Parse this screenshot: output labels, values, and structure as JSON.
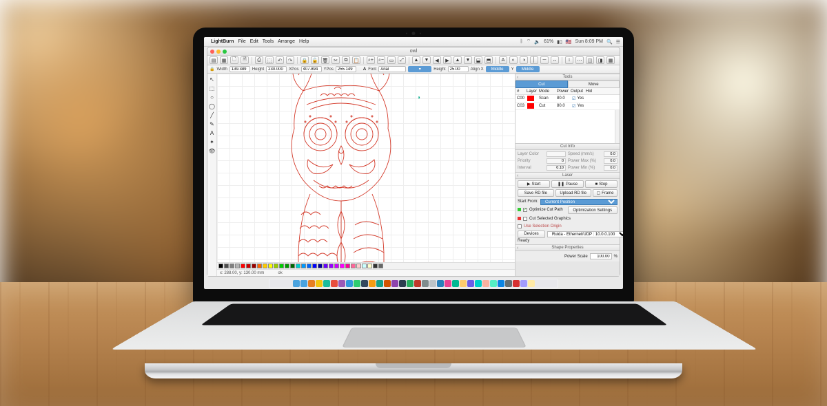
{
  "menubar": {
    "app": "LightBurn",
    "items": [
      "File",
      "Edit",
      "Tools",
      "Arrange",
      "Help"
    ],
    "battery": "61%",
    "time": "Sun 8:09 PM"
  },
  "window": {
    "title": "owl"
  },
  "toolbar_icons": [
    "▤",
    "▦",
    "🗋",
    "🗎",
    "⎙",
    "⬚",
    "↶",
    "↷",
    "🔒",
    "🔓",
    "🗑",
    "✂",
    "⧉",
    "📋",
    "⌕+",
    "⌕−",
    "▭",
    "⤢",
    "▲",
    "▼",
    "◀",
    "▶",
    "▲",
    "▼",
    "⬓",
    "⬒",
    "A",
    "◐",
    "◑",
    "│",
    "─",
    "↔",
    "↕",
    "⋯",
    "◫",
    "◨",
    "▦"
  ],
  "props": {
    "width_label": "Width",
    "width": "139.389",
    "height_label": "Height",
    "height": "230.000",
    "xpos_label": "XPos",
    "xpos": "407.894",
    "ypos_label": "YPos",
    "ypos": "255.149",
    "font_label": "Font",
    "font": "Arial",
    "height2_label": "Height",
    "height2": "25.00",
    "alignx_label": "Align X",
    "alignx": "Middle",
    "aligny_label": "Y",
    "aligny": "Middle"
  },
  "left_tools": [
    "↖",
    "⬚",
    "○",
    "◯",
    "╱",
    "✎",
    "A",
    "✦",
    "👁"
  ],
  "palette": [
    "#000000",
    "#4d4d4d",
    "#808080",
    "#b3b3b3",
    "#ff0000",
    "#cc0000",
    "#990000",
    "#ff6600",
    "#ffcc00",
    "#ffff00",
    "#99cc00",
    "#00cc00",
    "#009900",
    "#006600",
    "#00cccc",
    "#0099ff",
    "#0066ff",
    "#0000ff",
    "#000099",
    "#6600ff",
    "#9900ff",
    "#cc00ff",
    "#ff00ff",
    "#ff0099",
    "#ff6699",
    "#ffcccc",
    "#ccffff",
    "#ffffcc",
    "#333333",
    "#666666"
  ],
  "status": {
    "coords": "x: 288.00, y: 130.00 mm",
    "state": "ok"
  },
  "tools_panel": {
    "title": "Tools",
    "tabs": {
      "cut": "Cut",
      "move": "Move"
    },
    "headers": {
      "num": "#",
      "layer": "Layer",
      "mode": "Mode",
      "spd": "",
      "pwr": "Power",
      "out": "Output",
      "hid": "Hid"
    },
    "layers": [
      {
        "num": "C00",
        "color": "#ff0000",
        "mode": "Scan",
        "spd": "",
        "pwr": "80.0",
        "out": "Yes",
        "hid": ""
      },
      {
        "num": "C03",
        "color": "#ff0000",
        "mode": "Cut",
        "spd": "",
        "pwr": "80.0",
        "out": "Yes",
        "hid": ""
      }
    ]
  },
  "cutinfo": {
    "title": "Cut Info",
    "layer_color_label": "Layer Color",
    "layer_color": "",
    "speed_label": "Speed (mm/s)",
    "speed": "0.0",
    "priority_label": "Priority",
    "priority": "0",
    "power_max_label": "Power Max (%)",
    "power_max": "0.0",
    "interval_label": "Interval",
    "interval": "0.10",
    "power_min_label": "Power Min (%)",
    "power_min": "0.0"
  },
  "laser": {
    "title": "Laser",
    "start": "Start",
    "pause": "Pause",
    "stop": "Stop",
    "save_rd": "Save RD file",
    "upload_rd": "Upload RD file",
    "frame": "Frame",
    "start_from_label": "Start From:",
    "start_from": "Current Position",
    "optimize_cut": "Optimize Cut Path",
    "optimization_settings": "Optimization Settings",
    "cut_selected": "Cut Selected Graphics",
    "use_selection_origin": "Use Selection Origin",
    "devices_label": "Devices",
    "device": "Ruida - Ethernet/UDP : 10.0.0.100",
    "ready": "Ready"
  },
  "shape_props": {
    "title": "Shape Properties",
    "power_scale_label": "Power Scale",
    "power_scale": "100.00",
    "unit": "%"
  },
  "dock_colors": [
    "#4aa3df",
    "#4aa3df",
    "#e67e22",
    "#f1c40f",
    "#1abc9c",
    "#e74c3c",
    "#9b59b6",
    "#3498db",
    "#2ecc71",
    "#34495e",
    "#f39c12",
    "#16a085",
    "#d35400",
    "#8e44ad",
    "#2c3e50",
    "#27ae60",
    "#c0392b",
    "#7f8c8d",
    "#bdc3c7",
    "#2980b9",
    "#e84393",
    "#00b894",
    "#fdcb6e",
    "#6c5ce7",
    "#00cec9",
    "#fab1a0",
    "#55efc4",
    "#0984e3",
    "#636e72",
    "#d63031",
    "#a29bfe",
    "#ffeaa7"
  ]
}
